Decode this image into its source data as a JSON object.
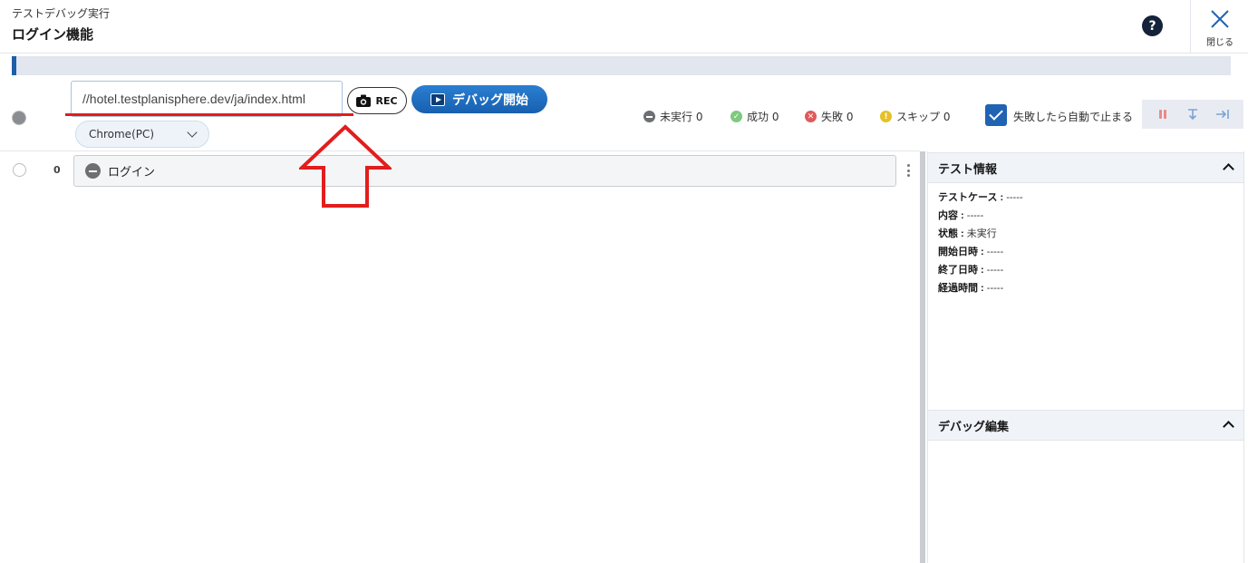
{
  "header": {
    "subtitle": "テストデバッグ実行",
    "title": "ログイン機能",
    "help_label": "?",
    "close_label": "閉じる"
  },
  "progress": {
    "fraction": 0.004
  },
  "toolbar": {
    "url_value": "//hotel.testplanisphere.dev/ja/index.html",
    "rec_label": "REC",
    "debug_start_label": "デバッグ開始",
    "browser_selected": "Chrome(PC)"
  },
  "stats": {
    "not_run": "未実行 0",
    "success": "成功 0",
    "fail": "失敗 0",
    "skip": "スキップ 0"
  },
  "stop_on_fail": {
    "label": "失敗したら自動で止まる",
    "checked": true
  },
  "steps": [
    {
      "index": "0",
      "label": "ログイン"
    }
  ],
  "test_info": {
    "heading": "テスト情報",
    "rows": [
      {
        "key": "テストケース :",
        "value": " -----"
      },
      {
        "key": "内容 :",
        "value": " -----"
      },
      {
        "key": "状態 :",
        "value": " 未実行"
      },
      {
        "key": "開始日時 :",
        "value": " -----"
      },
      {
        "key": "終了日時 :",
        "value": " -----"
      },
      {
        "key": "経過時間 :",
        "value": " -----"
      }
    ]
  },
  "debug_edit": {
    "heading": "デバッグ編集"
  },
  "colors": {
    "accent": "#1f63b3",
    "annotation_red": "#e21d1d"
  }
}
